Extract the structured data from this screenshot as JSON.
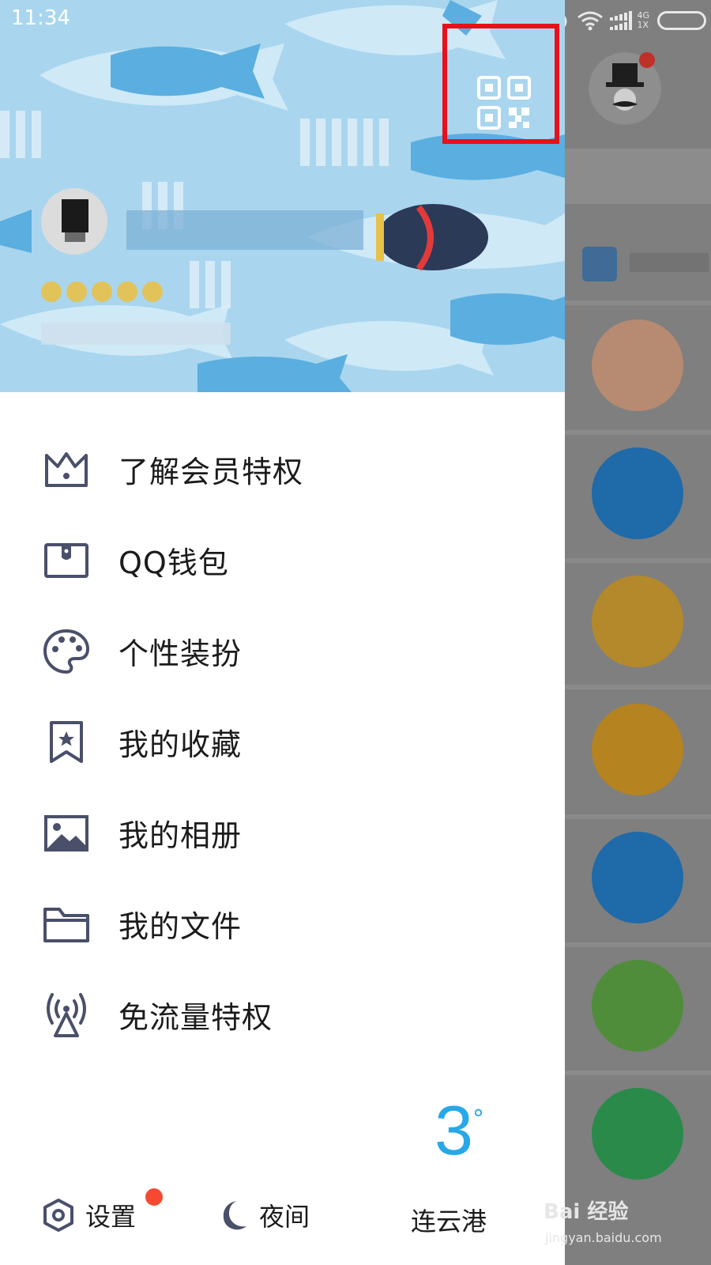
{
  "status_bar": {
    "time": "11:34",
    "network": "4G",
    "network2": "1X"
  },
  "header": {
    "qr_icon": "qr-code-icon"
  },
  "menu": {
    "items": [
      {
        "label": "了解会员特权",
        "icon": "crown-icon"
      },
      {
        "label": "QQ钱包",
        "icon": "wallet-icon"
      },
      {
        "label": "个性装扮",
        "icon": "palette-icon"
      },
      {
        "label": "我的收藏",
        "icon": "bookmark-star-icon"
      },
      {
        "label": "我的相册",
        "icon": "photo-album-icon"
      },
      {
        "label": "我的文件",
        "icon": "folder-icon"
      },
      {
        "label": "免流量特权",
        "icon": "broadcast-tower-icon"
      }
    ]
  },
  "bottom": {
    "settings_label": "设置",
    "night_label": "夜间",
    "weather": {
      "temp": "3",
      "degree": "°",
      "city": "连云港"
    }
  },
  "watermark": {
    "main": "Bai 经验",
    "sub": "jingyan.baidu.com"
  },
  "colors": {
    "accent": "#27a8e8",
    "highlight_frame": "#e8101a",
    "badge": "#f44a32",
    "icon": "#4a4f6a"
  }
}
